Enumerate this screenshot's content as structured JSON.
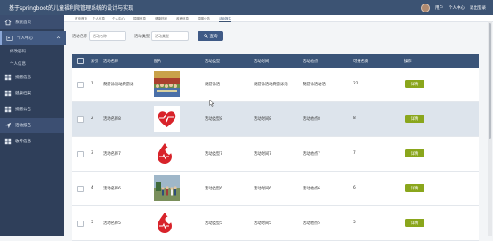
{
  "app": {
    "title": "基于springboot的儿童福利院管理系统的设计与实现"
  },
  "topbar": {
    "role": "用户",
    "personal": "个人中心",
    "logout": "退出登录"
  },
  "sidebar": {
    "home": "系统首页",
    "personal": "个人中心",
    "sub_items": [
      "修改密码",
      "个人信息"
    ],
    "menu": [
      "捐赠信息",
      "健康档案",
      "捐赠公告",
      "活动报名",
      "收养信息"
    ]
  },
  "tabs": [
    "首页首页",
    "个人信息",
    "个人中心",
    "捐赠信息",
    "健康档案",
    "收养信息",
    "捐赠公告",
    "活动报名"
  ],
  "search": {
    "name_label": "活动名称",
    "name_placeholder": "活动名称",
    "type_label": "活动类型",
    "type_placeholder": "活动类型",
    "button": "查询"
  },
  "table": {
    "headers": [
      "索引",
      "活动名称",
      "图片",
      "活动类型",
      "活动时间",
      "活动地点",
      "可报名数",
      "操作"
    ],
    "rows": [
      {
        "index": "1",
        "name": "爬游泳活动爬游泳",
        "image": "group-photo",
        "type": "爬游泳活",
        "time": "爬游泳活动爬游泳活",
        "place": "爬游泳活动活",
        "quota": "22",
        "action": "详情"
      },
      {
        "index": "2",
        "name": "活动名称8",
        "image": "heart-icon",
        "type": "活动类型8",
        "time": "活动时间8",
        "place": "活动地点8",
        "quota": "8",
        "action": "详情"
      },
      {
        "index": "3",
        "name": "活动名称7",
        "image": "blood-drop-heart",
        "type": "活动类型7",
        "time": "活动时间7",
        "place": "活动地点7",
        "quota": "7",
        "action": "详情"
      },
      {
        "index": "4",
        "name": "活动名称6",
        "image": "outdoor-group",
        "type": "活动类型6",
        "time": "活动时间6",
        "place": "活动地点6",
        "quota": "6",
        "action": "详情"
      },
      {
        "index": "5",
        "name": "活动名称5",
        "image": "blood-drop-heart",
        "type": "活动类型5",
        "time": "活动时间5",
        "place": "活动地点5",
        "quota": "5",
        "action": "详情"
      }
    ]
  },
  "colors": {
    "topbar": "#3c5373",
    "sidebar": "#2f3f5a",
    "accent": "#3f5a86",
    "button_detail": "#8aa61c",
    "heart": "#d8232a"
  }
}
